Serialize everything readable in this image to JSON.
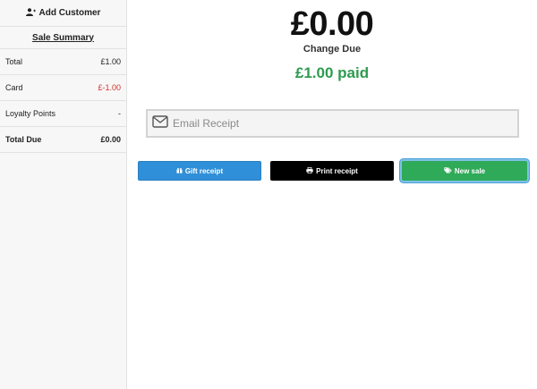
{
  "sidebar": {
    "add_customer_label": "Add Customer",
    "summary_title": "Sale Summary",
    "rows": [
      {
        "label": "Total",
        "value": "£1.00"
      },
      {
        "label": "Card",
        "value": "£-1.00"
      },
      {
        "label": "Loyalty Points",
        "value": "-"
      },
      {
        "label": "Total Due",
        "value": "£0.00"
      }
    ]
  },
  "main": {
    "change_amount": "£0.00",
    "change_label": "Change Due",
    "paid_text": "£1.00 paid",
    "email_placeholder": "Email Receipt"
  },
  "buttons": {
    "gift_label": "Gift receipt",
    "print_label": "Print receipt",
    "new_sale_label": "New sale"
  },
  "colors": {
    "paid_green": "#2e9b4f",
    "gift_blue": "#2f8fd8",
    "new_sale_green": "#2eaa58",
    "negative_red": "#d0342c"
  },
  "icons": {
    "add_customer": "user-plus-icon",
    "email": "envelope-icon",
    "gift": "gift-icon",
    "print": "print-icon",
    "new_sale": "tags-icon"
  }
}
